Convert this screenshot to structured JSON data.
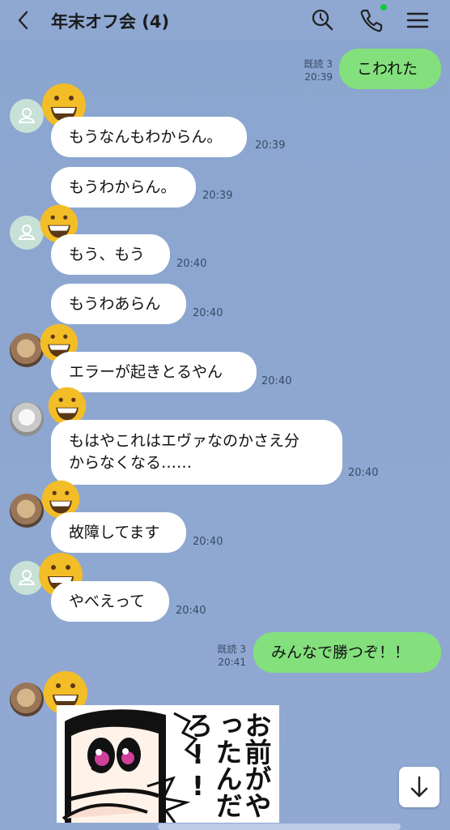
{
  "header": {
    "title": "年末オフ会 (4)"
  },
  "messages": [
    {
      "id": "m1",
      "side": "right",
      "text": "こわれた",
      "time": "20:39",
      "read": "既読 3"
    },
    {
      "id": "m2",
      "side": "left",
      "text": "もうなんもわからん。",
      "time": "20:39"
    },
    {
      "id": "m3",
      "side": "left",
      "text": "もうわからん。",
      "time": "20:39"
    },
    {
      "id": "m4",
      "side": "left",
      "text": "もう、もう",
      "time": "20:40"
    },
    {
      "id": "m5",
      "side": "left",
      "text": "もうわあらん",
      "time": "20:40"
    },
    {
      "id": "m6",
      "side": "left",
      "text": "エラーが起きとるやん",
      "time": "20:40"
    },
    {
      "id": "m7",
      "side": "left",
      "lines": [
        "もはやこれはエヴァなのかさえ分",
        "からなくなる……"
      ],
      "time": "20:40"
    },
    {
      "id": "m8",
      "side": "left",
      "text": "故障してます",
      "time": "20:40"
    },
    {
      "id": "m9",
      "side": "left",
      "text": "やべえって",
      "time": "20:40"
    },
    {
      "id": "m10",
      "side": "right",
      "text": "みんなで勝つぞ！！",
      "time": "20:41",
      "read": "既読 3"
    }
  ],
  "sticker": {
    "text": "お前がやったんだろ!!"
  },
  "colors": {
    "background": "#8ca6cd",
    "own_bubble": "#83e07c",
    "other_bubble": "#ffffff",
    "online_dot": "#14c93b"
  },
  "icons": [
    "back-icon",
    "search-icon",
    "phone-icon",
    "menu-icon",
    "scroll-down-icon"
  ]
}
